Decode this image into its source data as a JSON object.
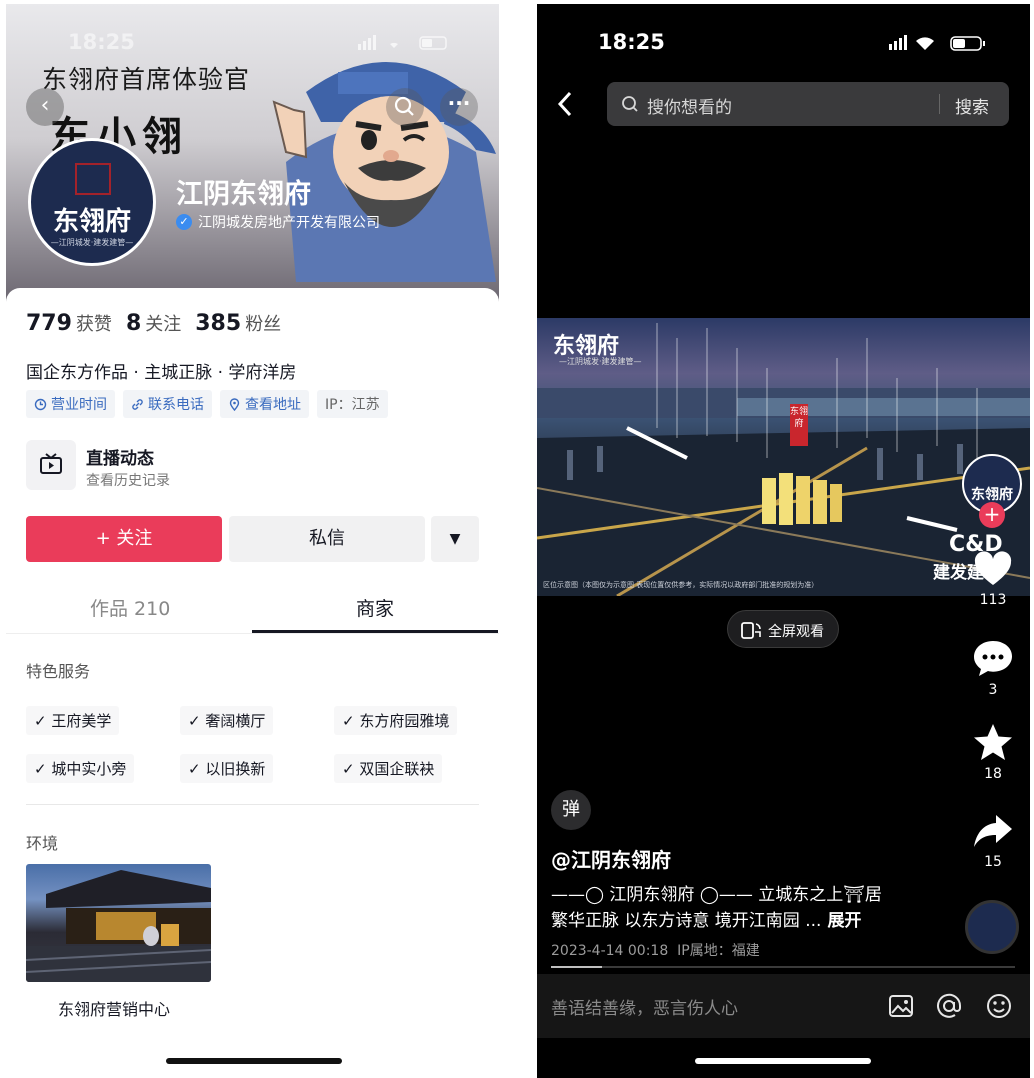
{
  "left": {
    "status": {
      "time": "18:25"
    },
    "banner": {
      "slogan": "东翎府首席体验官",
      "signature": "东小翎",
      "shop_name": "江阴东翎府",
      "verified_company": "江阴城发房地产开发有限公司"
    },
    "avatar": {
      "logo_text": "东翎府",
      "logo_sub": "—江阴城发·建发建管—"
    },
    "stats": {
      "likes_value": "779",
      "likes_label": "获赞",
      "following_value": "8",
      "following_label": "关注",
      "fans_value": "385",
      "fans_label": "粉丝"
    },
    "bio": "国企东方作品 · 主城正脉 · 学府洋房",
    "chips": [
      {
        "icon": "clock-icon",
        "label": "营业时间"
      },
      {
        "icon": "link-icon",
        "label": "联系电话"
      },
      {
        "icon": "location-icon",
        "label": "查看地址"
      },
      {
        "label": "IP：江苏"
      }
    ],
    "live": {
      "title": "直播动态",
      "subtitle": "查看历史记录"
    },
    "buttons": {
      "follow": "+ 关注",
      "message": "私信"
    },
    "tabs": {
      "works": "作品 210",
      "merchant": "商家"
    },
    "features_title": "特色服务",
    "features": [
      "王府美学",
      "奢阔横厅",
      "东方府园雅境",
      "城中实小旁",
      "以旧换新",
      "双国企联袂"
    ],
    "environment_title": "环境",
    "environment_caption": "东翎府营销中心"
  },
  "right": {
    "status": {
      "time": "18:25"
    },
    "search": {
      "placeholder": "搜你想看的",
      "button": "搜索"
    },
    "video": {
      "title": "东翎府",
      "subtitle": "—江阴城发·建发建管—",
      "tag": "东翎府",
      "disclaimer": "区位示意图（本图仅为示意图 表现位置仅供参考，实际情况以政府部门批准的规划为准）",
      "brand": "C&D",
      "brand_sub": "建发建管"
    },
    "fullscreen_label": "全屏观看",
    "actions": {
      "likes": "113",
      "comments": "3",
      "favorites": "18",
      "shares": "15"
    },
    "danmu": "弹",
    "author": "@江阴东翎府",
    "desc_line1": "——◯ 江阴东翎府 ◯—— 立城东之上⛩居",
    "desc_line2": "繁华正脉 以东方诗意 境开江南园 ...",
    "expand": "展开",
    "date": "2023-4-14 00:18",
    "ip": "IP属地：福建",
    "comment_placeholder": "善语结善缘，恶言伤人心",
    "progress": 0.11
  }
}
